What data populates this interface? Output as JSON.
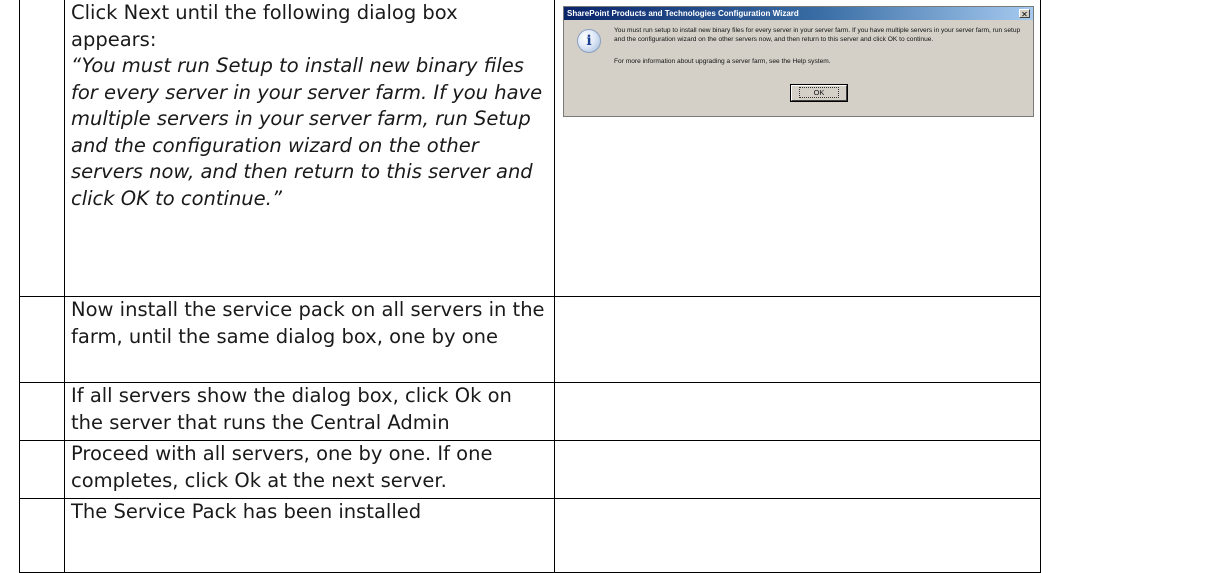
{
  "rows": [
    {
      "step": "",
      "text": "Click Next until the following dialog box appears:",
      "quote": "“You must run Setup to install new binary files for every server in your server farm. If you have multiple servers in your server farm, run Setup and the configuration wizard on the other servers now, and then return to this server and click OK to continue.”"
    },
    {
      "step": "",
      "text": "Now install the service pack on all servers in the farm, until the same dialog box, one by one"
    },
    {
      "step": "",
      "text": "If all servers show the dialog box, click Ok on the server that runs the Central Admin"
    },
    {
      "step": "",
      "text": "Proceed with all servers, one by one. If one completes, click Ok at the next server."
    },
    {
      "step": "",
      "text": "The Service Pack has been installed"
    }
  ],
  "dialog": {
    "title": "SharePoint Products and Technologies Configuration Wizard",
    "close_glyph": "✕",
    "icon": "information-icon",
    "icon_glyph": "i",
    "message": "You must run setup to install new binary files for every server in your server farm. If you have multiple servers in your server farm, run setup and the configuration wizard on the other servers now, and then return to this server and click OK to continue.",
    "more_info": "For more information about upgrading a server farm, see the Help system.",
    "ok_label": "OK"
  }
}
